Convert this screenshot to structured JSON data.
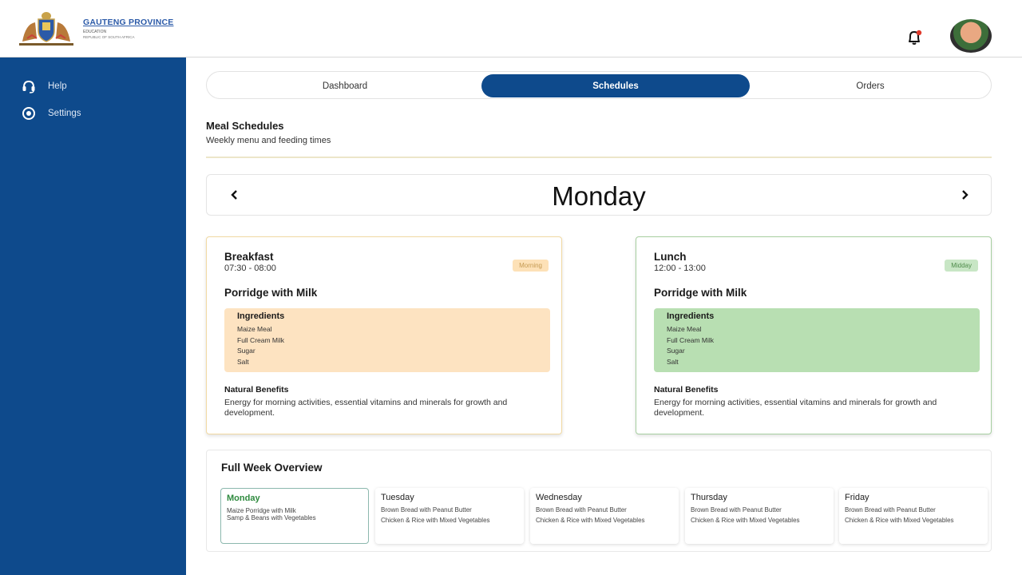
{
  "header": {
    "logo_title": "GAUTENG PROVINCE",
    "logo_subtitle": "EDUCATION",
    "logo_country": "REPUBLIC OF SOUTH AFRICA"
  },
  "sidebar": {
    "items": [
      {
        "label": "Help",
        "icon": "headset-icon"
      },
      {
        "label": "Settings",
        "icon": "settings-icon"
      }
    ]
  },
  "tabs": [
    {
      "label": "Dashboard",
      "active": false
    },
    {
      "label": "Schedules",
      "active": true
    },
    {
      "label": "Orders",
      "active": false
    }
  ],
  "section": {
    "title": "Meal Schedules",
    "subtitle": "Weekly menu and feeding times"
  },
  "day_nav": {
    "current_day": "Monday"
  },
  "meals": [
    {
      "name": "Breakfast",
      "time": "07:30 - 08:00",
      "badge": "Morning",
      "dish": "Porridge with Milk",
      "ingredients_title": "Ingredients",
      "ingredients": [
        "Maize Meal",
        "Full Cream Milk",
        "Sugar",
        "Salt"
      ],
      "benefits_title": "Natural Benefits",
      "benefits": "Energy for morning activities, essential vitamins and minerals for growth and development."
    },
    {
      "name": "Lunch",
      "time": "12:00 - 13:00",
      "badge": "Midday",
      "dish": "Porridge with Milk",
      "ingredients_title": "Ingredients",
      "ingredients": [
        "Maize Meal",
        "Full Cream Milk",
        "Sugar",
        "Salt"
      ],
      "benefits_title": "Natural Benefits",
      "benefits": "Energy for morning activities, essential vitamins and minerals for growth and development."
    }
  ],
  "week": {
    "title": "Full Week Overview",
    "days": [
      {
        "name": "Monday",
        "meal1": "Maize Porridge with Milk",
        "meal2": "Samp & Beans with Vegetables",
        "active": true
      },
      {
        "name": "Tuesday",
        "meal1": "Brown Bread with Peanut Butter",
        "meal2": "Chicken & Rice with Mixed Vegetables",
        "active": false
      },
      {
        "name": "Wednesday",
        "meal1": "Brown Bread with Peanut Butter",
        "meal2": "Chicken & Rice with Mixed Vegetables",
        "active": false
      },
      {
        "name": "Thursday",
        "meal1": "Brown Bread with Peanut Butter",
        "meal2": "Chicken & Rice with Mixed Vegetables",
        "active": false
      },
      {
        "name": "Friday",
        "meal1": "Brown Bread with Peanut Butter",
        "meal2": "Chicken & Rice with Mixed Vegetables",
        "active": false
      }
    ]
  },
  "colors": {
    "brand": "#0e4a8c",
    "breakfast_bg": "#fde3c1",
    "lunch_bg": "#b8dfb2",
    "active_day": "#2e8a3e"
  }
}
